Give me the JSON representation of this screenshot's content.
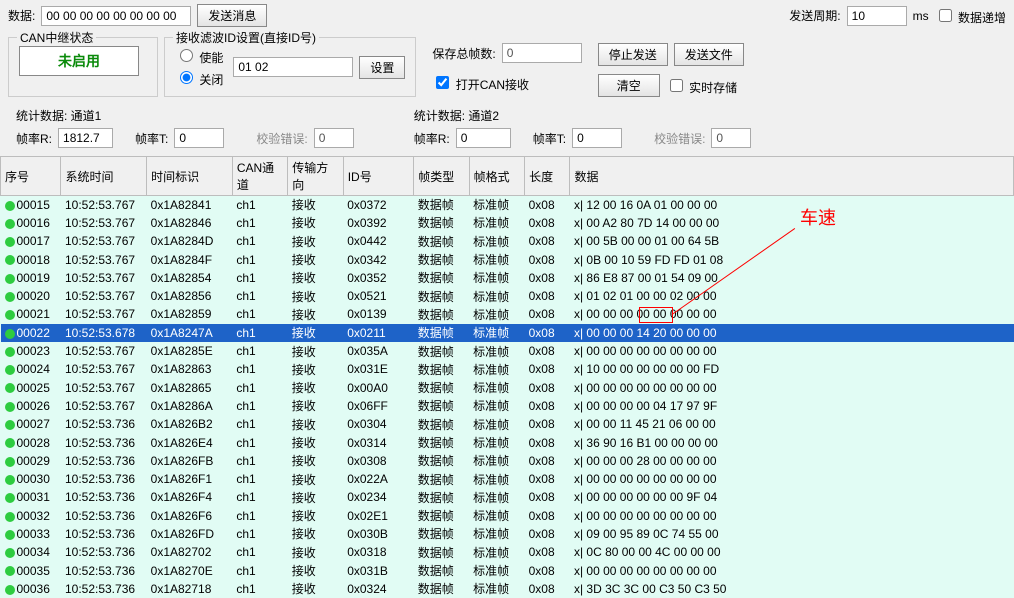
{
  "top": {
    "dataLabel": "数据:",
    "dataValue": "00 00 00 00 00 00 00 00",
    "sendMsg": "发送消息",
    "periodLabel": "发送周期:",
    "periodValue": "10",
    "ms": "ms",
    "autoInc": "数据递增"
  },
  "relay": {
    "title": "CAN中继状态",
    "notEnabled": "未启用"
  },
  "filter": {
    "title": "接收滤波ID设置(直接ID号)",
    "enable": "使能",
    "close": "关闭",
    "ids": "01 02",
    "set": "设置"
  },
  "save": {
    "totalLabel": "保存总帧数:",
    "totalValue": "0",
    "openCan": "打开CAN接收"
  },
  "ctrl": {
    "stopSend": "停止发送",
    "sendFile": "发送文件",
    "clear": "清空",
    "realtime": "实时存储"
  },
  "stats1": {
    "title": "统计数据: 通道1",
    "rateR": "帧率R:",
    "rateRVal": "1812.7",
    "rateT": "帧率T:",
    "rateTVal": "0",
    "chk": "校验错误:",
    "chkVal": "0"
  },
  "stats2": {
    "title": "统计数据: 通道2",
    "rateR": "帧率R:",
    "rateRVal": "0",
    "rateT": "帧率T:",
    "rateTVal": "0",
    "chk": "校验错误:",
    "chkVal": "0"
  },
  "headers": [
    "序号",
    "系统时间",
    "时间标识",
    "CAN通道",
    "传输方向",
    "ID号",
    "帧类型",
    "帧格式",
    "长度",
    "数据"
  ],
  "annotation": "车速",
  "cols": [
    60,
    85,
    85,
    55,
    55,
    70,
    55,
    55,
    45,
    440
  ],
  "rows": [
    {
      "n": "00015",
      "t": "10:52:53.767",
      "ts": "0x1A82841",
      "ch": "ch1",
      "dir": "接收",
      "id": "0x0372",
      "ty": "数据帧",
      "fmt": "标准帧",
      "len": "0x08",
      "d": "x| 12 00 16 0A 01 00 00 00"
    },
    {
      "n": "00016",
      "t": "10:52:53.767",
      "ts": "0x1A82846",
      "ch": "ch1",
      "dir": "接收",
      "id": "0x0392",
      "ty": "数据帧",
      "fmt": "标准帧",
      "len": "0x08",
      "d": "x| 00 A2 80 7D 14 00 00 00"
    },
    {
      "n": "00017",
      "t": "10:52:53.767",
      "ts": "0x1A8284D",
      "ch": "ch1",
      "dir": "接收",
      "id": "0x0442",
      "ty": "数据帧",
      "fmt": "标准帧",
      "len": "0x08",
      "d": "x| 00 5B 00 00 01 00 64 5B"
    },
    {
      "n": "00018",
      "t": "10:52:53.767",
      "ts": "0x1A8284F",
      "ch": "ch1",
      "dir": "接收",
      "id": "0x0342",
      "ty": "数据帧",
      "fmt": "标准帧",
      "len": "0x08",
      "d": "x| 0B 00 10 59 FD FD 01 08"
    },
    {
      "n": "00019",
      "t": "10:52:53.767",
      "ts": "0x1A82854",
      "ch": "ch1",
      "dir": "接收",
      "id": "0x0352",
      "ty": "数据帧",
      "fmt": "标准帧",
      "len": "0x08",
      "d": "x| 86 E8 87 00 01 54 09 00"
    },
    {
      "n": "00020",
      "t": "10:52:53.767",
      "ts": "0x1A82856",
      "ch": "ch1",
      "dir": "接收",
      "id": "0x0521",
      "ty": "数据帧",
      "fmt": "标准帧",
      "len": "0x08",
      "d": "x| 01 02 01 00 00 02 00 00"
    },
    {
      "n": "00021",
      "t": "10:52:53.767",
      "ts": "0x1A82859",
      "ch": "ch1",
      "dir": "接收",
      "id": "0x0139",
      "ty": "数据帧",
      "fmt": "标准帧",
      "len": "0x08",
      "d": "x| 00 00 00 00 00 00 00 00"
    },
    {
      "n": "00022",
      "t": "10:52:53.678",
      "ts": "0x1A8247A",
      "ch": "ch1",
      "dir": "接收",
      "id": "0x0211",
      "ty": "数据帧",
      "fmt": "标准帧",
      "len": "0x08",
      "d": "x| 00 00 00 14 20 00 00 00",
      "sel": true
    },
    {
      "n": "00023",
      "t": "10:52:53.767",
      "ts": "0x1A8285E",
      "ch": "ch1",
      "dir": "接收",
      "id": "0x035A",
      "ty": "数据帧",
      "fmt": "标准帧",
      "len": "0x08",
      "d": "x| 00 00 00 00 00 00 00 00"
    },
    {
      "n": "00024",
      "t": "10:52:53.767",
      "ts": "0x1A82863",
      "ch": "ch1",
      "dir": "接收",
      "id": "0x031E",
      "ty": "数据帧",
      "fmt": "标准帧",
      "len": "0x08",
      "d": "x| 10 00 00 00 00 00 00 FD"
    },
    {
      "n": "00025",
      "t": "10:52:53.767",
      "ts": "0x1A82865",
      "ch": "ch1",
      "dir": "接收",
      "id": "0x00A0",
      "ty": "数据帧",
      "fmt": "标准帧",
      "len": "0x08",
      "d": "x| 00 00 00 00 00 00 00 00"
    },
    {
      "n": "00026",
      "t": "10:52:53.767",
      "ts": "0x1A8286A",
      "ch": "ch1",
      "dir": "接收",
      "id": "0x06FF",
      "ty": "数据帧",
      "fmt": "标准帧",
      "len": "0x08",
      "d": "x| 00 00 00 00 04 17 97 9F"
    },
    {
      "n": "00027",
      "t": "10:52:53.736",
      "ts": "0x1A826B2",
      "ch": "ch1",
      "dir": "接收",
      "id": "0x0304",
      "ty": "数据帧",
      "fmt": "标准帧",
      "len": "0x08",
      "d": "x| 00 00 11 45 21 06 00 00"
    },
    {
      "n": "00028",
      "t": "10:52:53.736",
      "ts": "0x1A826E4",
      "ch": "ch1",
      "dir": "接收",
      "id": "0x0314",
      "ty": "数据帧",
      "fmt": "标准帧",
      "len": "0x08",
      "d": "x| 36 90 16 B1 00 00 00 00"
    },
    {
      "n": "00029",
      "t": "10:52:53.736",
      "ts": "0x1A826FB",
      "ch": "ch1",
      "dir": "接收",
      "id": "0x0308",
      "ty": "数据帧",
      "fmt": "标准帧",
      "len": "0x08",
      "d": "x| 00 00 00 28 00 00 00 00"
    },
    {
      "n": "00030",
      "t": "10:52:53.736",
      "ts": "0x1A826F1",
      "ch": "ch1",
      "dir": "接收",
      "id": "0x022A",
      "ty": "数据帧",
      "fmt": "标准帧",
      "len": "0x08",
      "d": "x| 00 00 00 00 00 00 00 00"
    },
    {
      "n": "00031",
      "t": "10:52:53.736",
      "ts": "0x1A826F4",
      "ch": "ch1",
      "dir": "接收",
      "id": "0x0234",
      "ty": "数据帧",
      "fmt": "标准帧",
      "len": "0x08",
      "d": "x| 00 00 00 00 00 00 9F 04"
    },
    {
      "n": "00032",
      "t": "10:52:53.736",
      "ts": "0x1A826F6",
      "ch": "ch1",
      "dir": "接收",
      "id": "0x02E1",
      "ty": "数据帧",
      "fmt": "标准帧",
      "len": "0x08",
      "d": "x| 00 00 00 00 00 00 00 00"
    },
    {
      "n": "00033",
      "t": "10:52:53.736",
      "ts": "0x1A826FD",
      "ch": "ch1",
      "dir": "接收",
      "id": "0x030B",
      "ty": "数据帧",
      "fmt": "标准帧",
      "len": "0x08",
      "d": "x| 09 00 95 89 0C 74 55 00"
    },
    {
      "n": "00034",
      "t": "10:52:53.736",
      "ts": "0x1A82702",
      "ch": "ch1",
      "dir": "接收",
      "id": "0x0318",
      "ty": "数据帧",
      "fmt": "标准帧",
      "len": "0x08",
      "d": "x| 0C 80 00 00 4C 00 00 00"
    },
    {
      "n": "00035",
      "t": "10:52:53.736",
      "ts": "0x1A8270E",
      "ch": "ch1",
      "dir": "接收",
      "id": "0x031B",
      "ty": "数据帧",
      "fmt": "标准帧",
      "len": "0x08",
      "d": "x| 00 00 00 00 00 00 00 00"
    },
    {
      "n": "00036",
      "t": "10:52:53.736",
      "ts": "0x1A82718",
      "ch": "ch1",
      "dir": "接收",
      "id": "0x0324",
      "ty": "数据帧",
      "fmt": "标准帧",
      "len": "0x08",
      "d": "x| 3D 3C 3C 00 C3 50 C3 50"
    }
  ]
}
